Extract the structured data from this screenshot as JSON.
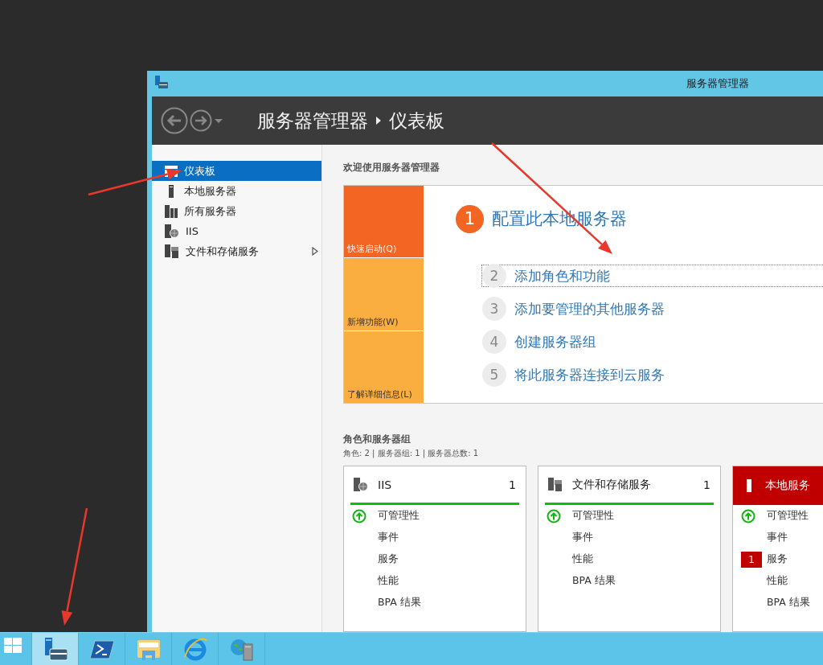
{
  "window": {
    "title": "服务器管理器"
  },
  "header": {
    "breadcrumb": [
      "服务器管理器",
      "仪表板"
    ]
  },
  "sidebar": {
    "items": [
      {
        "label": "仪表板",
        "kind": "dashboard",
        "selected": true,
        "expandable": false
      },
      {
        "label": "本地服务器",
        "kind": "server",
        "selected": false,
        "expandable": false
      },
      {
        "label": "所有服务器",
        "kind": "servers",
        "selected": false,
        "expandable": false
      },
      {
        "label": "IIS",
        "kind": "iis",
        "selected": false,
        "expandable": false
      },
      {
        "label": "文件和存储服务",
        "kind": "storage",
        "selected": false,
        "expandable": true
      }
    ]
  },
  "welcome": {
    "heading": "欢迎使用服务器管理器",
    "tiles": [
      {
        "label": "快速启动(Q)",
        "selected": true
      },
      {
        "label": "新增功能(W)",
        "selected": false
      },
      {
        "label": "了解详细信息(L)",
        "selected": false
      }
    ],
    "steps": [
      {
        "number": "1",
        "label": "配置此本地服务器",
        "kind": "primary",
        "focused": false
      },
      {
        "number": "2",
        "label": "添加角色和功能",
        "kind": "secondary",
        "focused": true
      },
      {
        "number": "3",
        "label": "添加要管理的其他服务器",
        "kind": "secondary",
        "focused": false
      },
      {
        "number": "4",
        "label": "创建服务器组",
        "kind": "secondary",
        "focused": false
      },
      {
        "number": "5",
        "label": "将此服务器连接到云服务",
        "kind": "secondary",
        "focused": false
      }
    ]
  },
  "roles": {
    "heading": "角色和服务器组",
    "summary": "角色: 2 | 服务器组: 1 | 服务器总数: 1",
    "cards": [
      {
        "title": "IIS",
        "kind": "iis",
        "count": "1",
        "alert": false,
        "rows": [
          {
            "label": "可管理性",
            "kind": "ok"
          },
          {
            "label": "事件",
            "kind": "plain"
          },
          {
            "label": "服务",
            "kind": "plain"
          },
          {
            "label": "性能",
            "kind": "plain"
          },
          {
            "label": "BPA 结果",
            "kind": "plain"
          }
        ]
      },
      {
        "title": "文件和存储服务",
        "kind": "storage",
        "count": "1",
        "alert": false,
        "rows": [
          {
            "label": "可管理性",
            "kind": "ok"
          },
          {
            "label": "事件",
            "kind": "plain"
          },
          {
            "label": "性能",
            "kind": "plain"
          },
          {
            "label": "BPA 结果",
            "kind": "plain"
          }
        ]
      },
      {
        "title": "本地服务",
        "kind": "server",
        "alert": true,
        "rows": [
          {
            "label": "可管理性",
            "kind": "ok"
          },
          {
            "label": "事件",
            "kind": "plain"
          },
          {
            "label": "服务",
            "kind": "badge",
            "badge": "1"
          },
          {
            "label": "性能",
            "kind": "plain"
          },
          {
            "label": "BPA 结果",
            "kind": "plain"
          }
        ]
      }
    ]
  },
  "taskbar": {
    "items": [
      {
        "kind": "start",
        "active": false
      },
      {
        "kind": "server-manager",
        "active": true
      },
      {
        "kind": "powershell",
        "active": false
      },
      {
        "kind": "explorer",
        "active": false
      },
      {
        "kind": "browser",
        "active": false
      },
      {
        "kind": "server-globe",
        "active": false
      }
    ]
  }
}
